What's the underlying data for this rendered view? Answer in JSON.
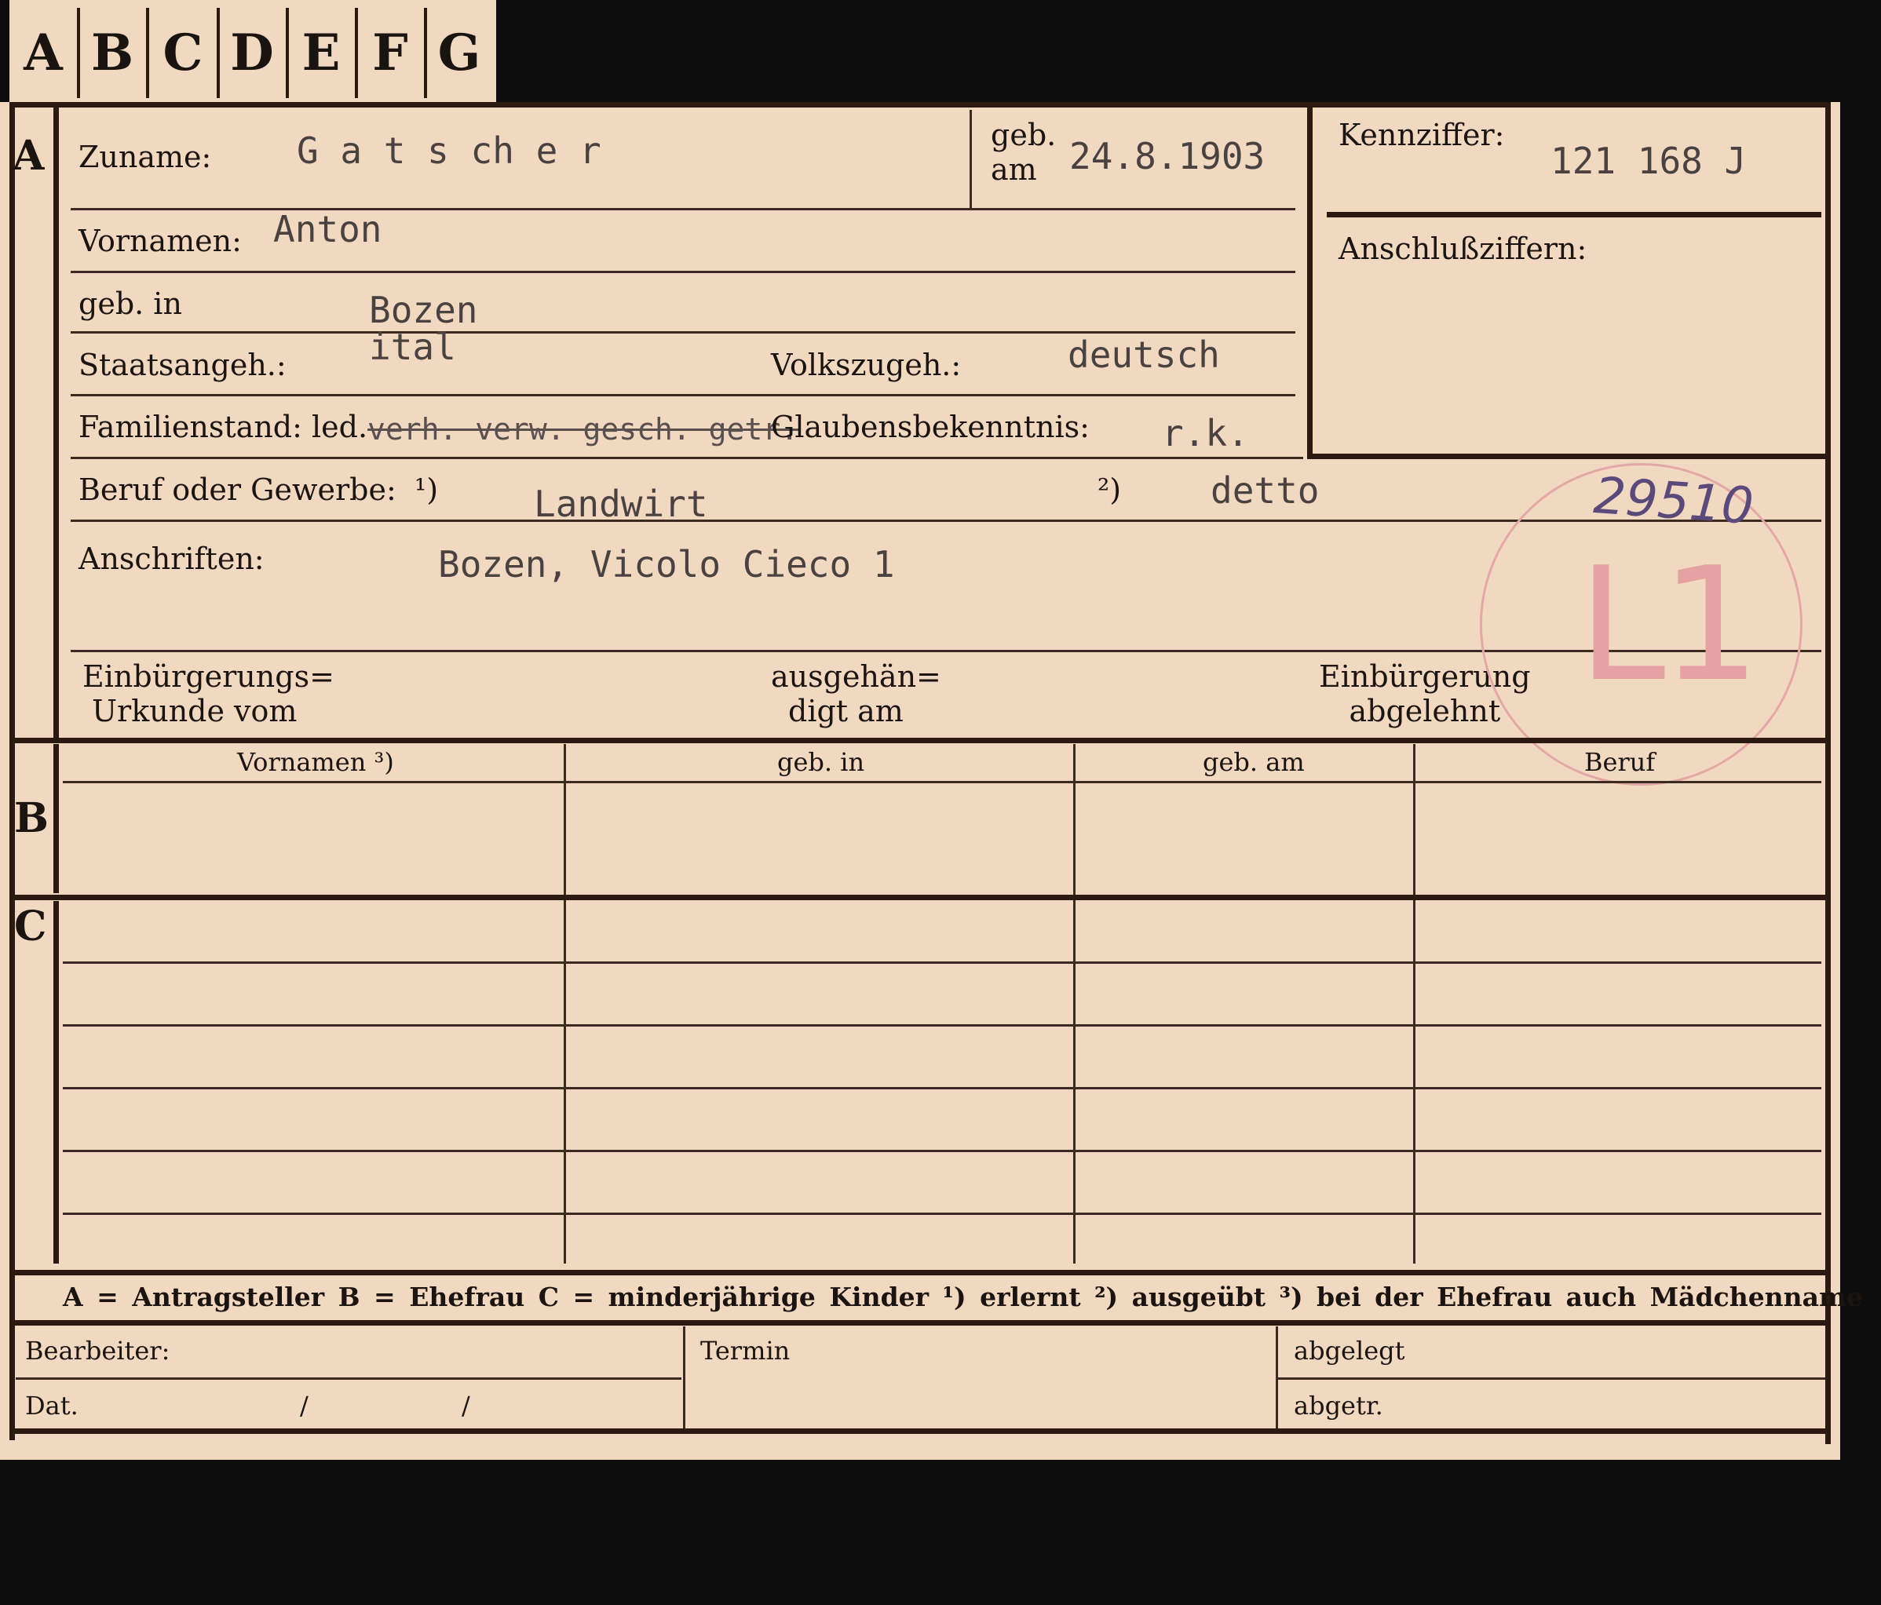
{
  "tabs": [
    "A",
    "B",
    "C",
    "D",
    "E",
    "F",
    "G"
  ],
  "section_letters": {
    "a": "A",
    "b": "B",
    "c": "C"
  },
  "labels": {
    "zuname": "Zuname:",
    "geb_am": "geb.\nam",
    "geb_am_line1": "geb.",
    "geb_am_line2": "am",
    "kennziffer": "Kennziffer:",
    "vornamen": "Vornamen:",
    "anschlussziffern": "Anschlußziffern:",
    "geb_in": "geb. in",
    "staatsangeh": "Staatsangeh.:",
    "volkszugeh": "Volkszugeh.:",
    "familienstand": "Familienstand: led.",
    "glaubensbekenntnis": "Glaubensbekenntnis:",
    "beruf": "Beruf oder Gewerbe:",
    "beruf_note1": "¹)",
    "beruf_note2": "²)",
    "anschriften": "Anschriften:",
    "einb_urkunde_1": "Einbürgerungs=",
    "einb_urkunde_2": "Urkunde vom",
    "ausgehaendigt_1": "ausgehän=",
    "ausgehaendigt_2": "digt am",
    "einb_abgelehnt_1": "Einbürgerung",
    "einb_abgelehnt_2": "abgelehnt",
    "col_vornamen": "Vornamen ³)",
    "col_geb_in": "geb. in",
    "col_geb_am": "geb. am",
    "col_beruf": "Beruf",
    "legend": "A = Antragsteller  B = Ehefrau  C = minderjährige Kinder  ¹) erlernt  ²) ausgeübt  ³) bei der Ehefrau auch Mädchenname",
    "bearbeiter": "Bearbeiter:",
    "dat": "Dat.",
    "slash": "/",
    "termin": "Termin",
    "abgelegt": "abgelegt",
    "abgetr": "abgetr."
  },
  "values": {
    "zuname": "G a t s ch e r",
    "geb_am": "24.8.1903",
    "kennziffer": "121 168 J",
    "vornamen": "Anton",
    "geb_in": "Bozen",
    "staatsangeh": "ital",
    "volkszugeh": "deutsch",
    "familienstand_struck": "verh. verw. gesch. getr.",
    "glaubensbekenntnis": "r.k.",
    "beruf_erlernt": "Landwirt",
    "beruf_ausgeuebt": "detto",
    "anschriften": "Bozen, Vicolo Cieco 1"
  },
  "stamp": {
    "text": "L1",
    "handwritten_number": "29510",
    "color": "#e6a1a3"
  },
  "colors": {
    "card": "#f1d8c0",
    "ink": "#1b1410",
    "typewriter": "#4a4240",
    "background": "#0d0d0d"
  }
}
